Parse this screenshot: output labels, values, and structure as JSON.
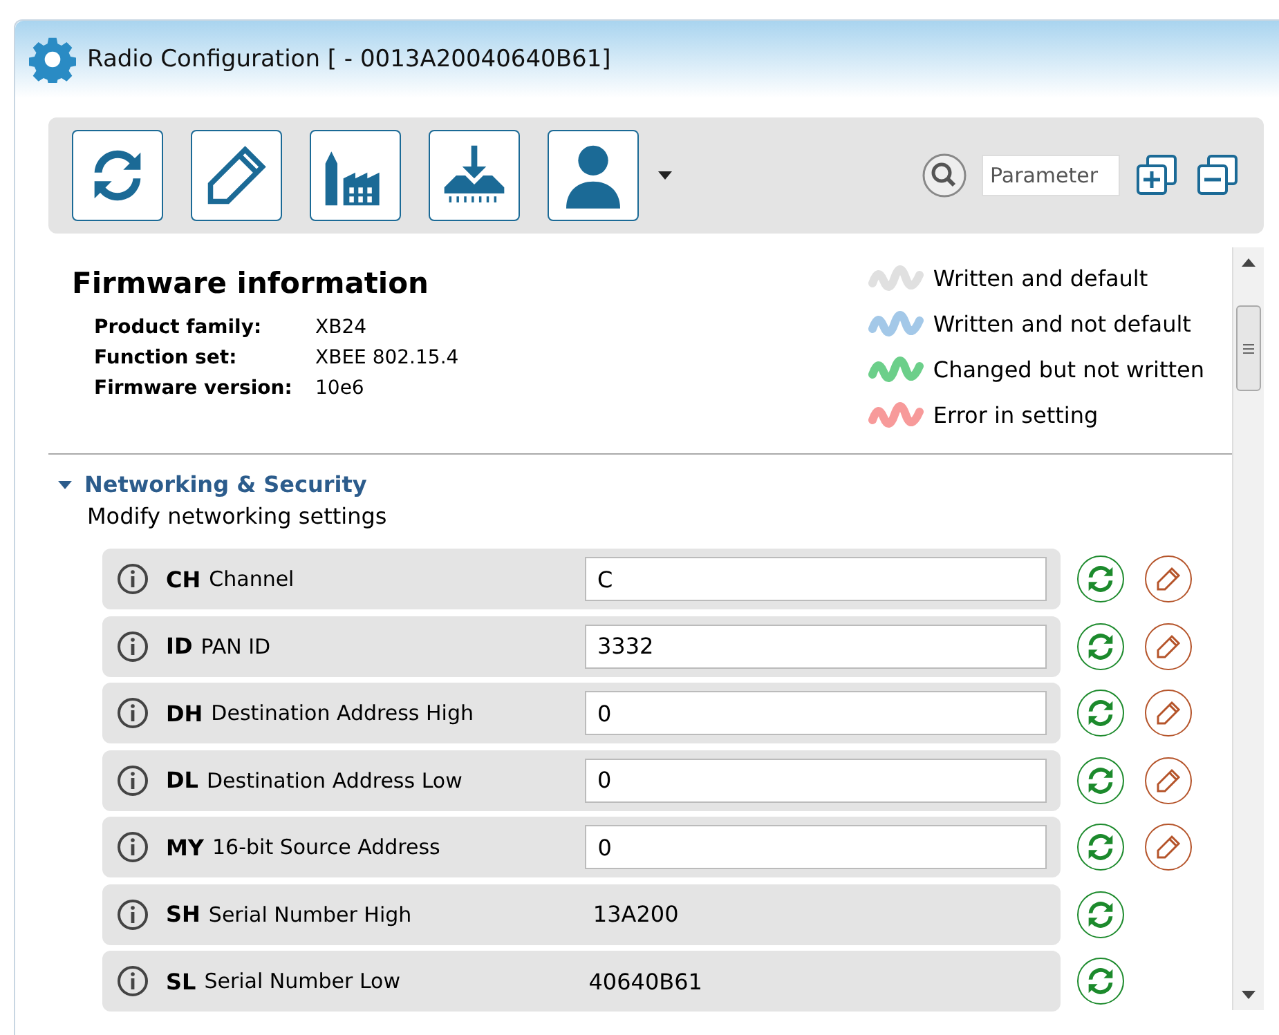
{
  "window": {
    "title": "Radio Configuration [  - 0013A20040640B61]"
  },
  "toolbar": {
    "search": {
      "placeholder": "Parameter"
    }
  },
  "firmware": {
    "title": "Firmware information",
    "fields": [
      {
        "label": "Product family:",
        "value": "XB24"
      },
      {
        "label": "Function set:",
        "value": "XBEE 802.15.4"
      },
      {
        "label": "Firmware version:",
        "value": "10e6"
      }
    ]
  },
  "legend": [
    {
      "label": "Written and default",
      "color": "#e0e0e0"
    },
    {
      "label": "Written and not default",
      "color": "#a3c8e8"
    },
    {
      "label": "Changed but not written",
      "color": "#6ccf8a"
    },
    {
      "label": "Error in setting",
      "color": "#f79a9a"
    }
  ],
  "section": {
    "title": "Networking & Security",
    "description": "Modify networking settings",
    "expanded": true,
    "params": [
      {
        "kind": "editable",
        "code": "CH",
        "name": "Channel",
        "value": "C"
      },
      {
        "kind": "editable",
        "code": "ID",
        "name": "PAN ID",
        "value": "3332"
      },
      {
        "kind": "editable",
        "code": "DH",
        "name": "Destination Address High",
        "value": "0"
      },
      {
        "kind": "editable",
        "code": "DL",
        "name": "Destination Address Low",
        "value": "0"
      },
      {
        "kind": "editable",
        "code": "MY",
        "name": "16-bit Source Address",
        "value": "0"
      },
      {
        "kind": "readonly",
        "code": "SH",
        "name": "Serial Number High",
        "value": "13A200"
      },
      {
        "kind": "readonly",
        "code": "SL",
        "name": "Serial Number Low",
        "value": "40640B61"
      }
    ]
  }
}
